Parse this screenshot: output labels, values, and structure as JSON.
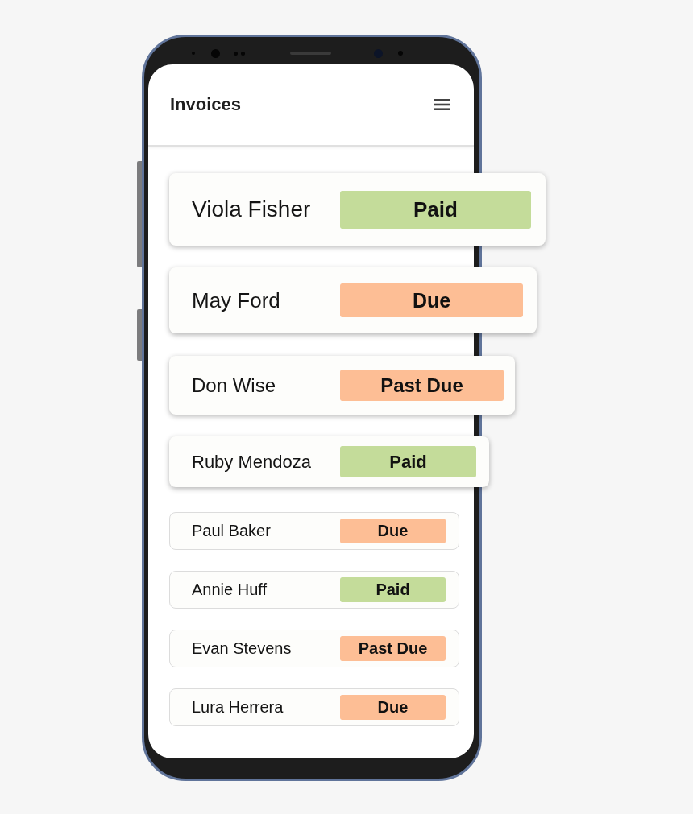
{
  "header": {
    "title": "Invoices"
  },
  "invoices": [
    {
      "name": "Viola Fisher",
      "status": "Paid",
      "color": "#c4dc9a",
      "kind": "raised"
    },
    {
      "name": "May Ford",
      "status": "Due",
      "color": "#fdbe95",
      "kind": "raised"
    },
    {
      "name": "Don Wise",
      "status": "Past Due",
      "color": "#fdbe95",
      "kind": "raised"
    },
    {
      "name": "Ruby Mendoza",
      "status": "Paid",
      "color": "#c4dc9a",
      "kind": "raised"
    },
    {
      "name": "Paul Baker",
      "status": "Due",
      "color": "#fdbe95",
      "kind": "flat"
    },
    {
      "name": "Annie Huff",
      "status": "Paid",
      "color": "#c4dc9a",
      "kind": "flat"
    },
    {
      "name": "Evan Stevens",
      "status": "Past Due",
      "color": "#fdbe95",
      "kind": "flat"
    },
    {
      "name": "Lura Herrera",
      "status": "Due",
      "color": "#fdbe95",
      "kind": "flat"
    }
  ]
}
